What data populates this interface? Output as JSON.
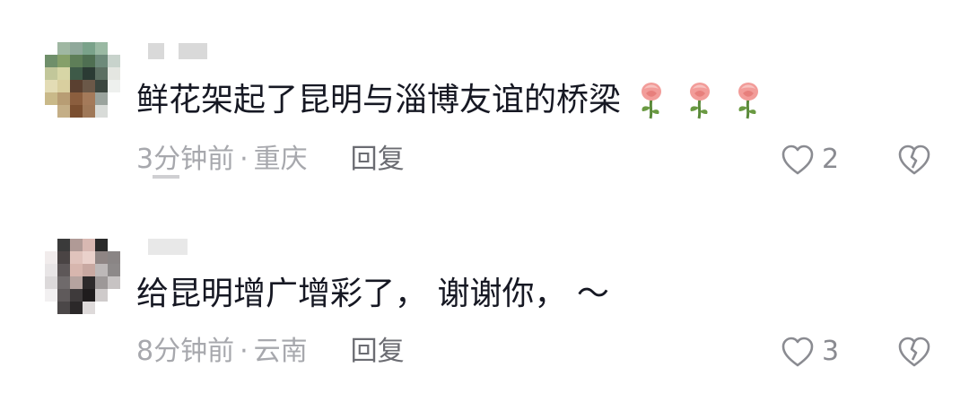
{
  "comments": [
    {
      "content": "鲜花架起了昆明与淄博友谊的桥梁",
      "emoji_count": 3,
      "emoji": "rose-icon",
      "time": "3分钟前",
      "separator": "·",
      "location": "重庆",
      "reply_label": "回复",
      "likes": "2"
    },
    {
      "content": "给昆明增广增彩了， 谢谢你， ～",
      "time": "8分钟前",
      "separator": "·",
      "location": "云南",
      "reply_label": "回复",
      "likes": "3"
    }
  ],
  "colors": {
    "text": "#161823",
    "meta": "#a7a8ad",
    "reply": "#6b6c72",
    "icon": "#8a8b91"
  }
}
